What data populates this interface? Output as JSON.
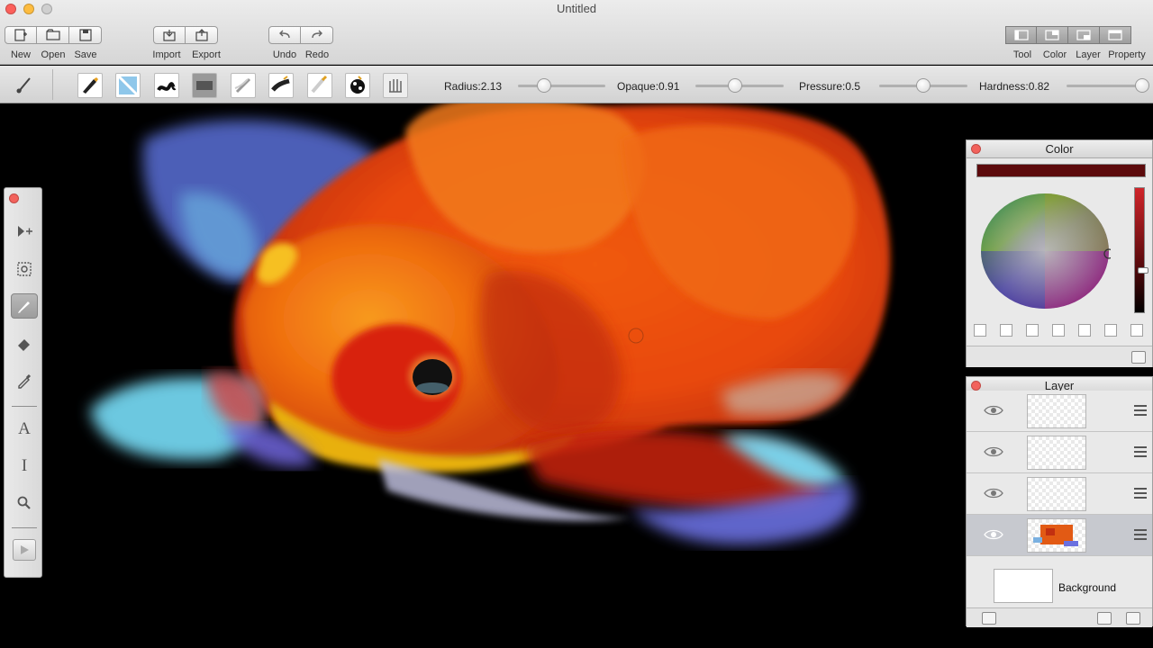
{
  "window": {
    "title": "Untitled"
  },
  "toolbar": {
    "new_label": "New",
    "open_label": "Open",
    "save_label": "Save",
    "import_label": "Import",
    "export_label": "Export",
    "undo_label": "Undo",
    "redo_label": "Redo",
    "tool_label": "Tool",
    "color_label": "Color",
    "layer_label": "Layer",
    "property_label": "Property"
  },
  "brush_settings": {
    "radius_label": "Radius:2.13",
    "radius_value": 0.3,
    "opaque_label": "Opaque:0.91",
    "opaque_value": 0.45,
    "pressure_label": "Pressure:0.5",
    "pressure_value": 0.5,
    "hardness_label": "Hardness:0.82",
    "hardness_value": 0.95
  },
  "color_panel": {
    "title": "Color",
    "current_color": "#5c0a0c"
  },
  "layer_panel": {
    "title": "Layer",
    "background_label": "Background"
  },
  "colors": {
    "accent_close": "#f2625c"
  }
}
